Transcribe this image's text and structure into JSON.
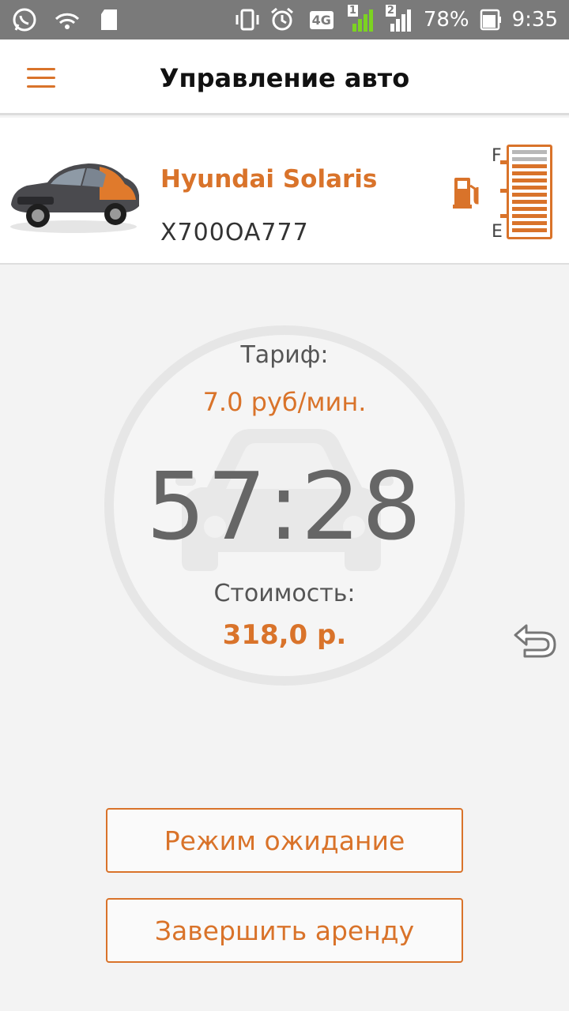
{
  "status_bar": {
    "left_icons": [
      "whatsapp-icon",
      "wifi-hotspot-icon",
      "sd-card-icon"
    ],
    "right_icons": [
      "vibrate-icon",
      "alarm-icon",
      "network-4g-icon",
      "signal-sim1-icon",
      "signal-sim2-icon",
      "battery-icon"
    ],
    "network": "4G",
    "sim1": "1",
    "sim2": "2",
    "battery": "78%",
    "battery_level": 0.78,
    "time": "9:35"
  },
  "app_bar": {
    "title": "Управление авто",
    "menu_icon": "hamburger-menu-icon"
  },
  "car": {
    "name": "Hyundai Solaris",
    "plate": "X700OA777",
    "fuel": {
      "full_label": "F",
      "empty_label": "E",
      "level": 0.83,
      "segments_total": 12,
      "segments_filled": 10
    }
  },
  "timer": {
    "tariff_label": "Тариф:",
    "tariff_value": "7.0 руб/мин.",
    "elapsed": "57:28",
    "cost_label": "Стоимость:",
    "cost_value": "318,0 р."
  },
  "actions": {
    "wait_mode": "Режим ожидание",
    "finish_rent": "Завершить аренду"
  },
  "colors": {
    "accent": "#d9732a",
    "background": "#f3f3f3",
    "status_bar": "#7a7a7a"
  }
}
